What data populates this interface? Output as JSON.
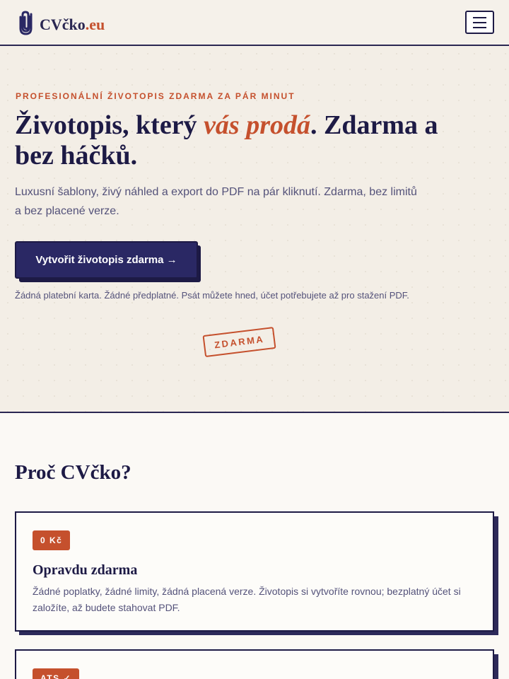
{
  "header": {
    "logo_main": "CVčko",
    "logo_tld": ".eu",
    "logo_icon": "paperclip-icon",
    "menu_icon": "hamburger-menu-icon"
  },
  "hero": {
    "eyebrow": "PROFESIONÁLNÍ ŽIVOTOPIS ZDARMA ZA PÁR MINUT",
    "headline_before": "Životopis, který ",
    "headline_accent": "vás prodá",
    "headline_after": ". Zdarma a bez háčků.",
    "lead": "Luxusní šablony, živý náhled a export do PDF na pár kliknutí. Zdarma, bez limitů a bez placené verze.",
    "cta_label": "Vytvořit životopis zdarma →",
    "note": "Žádná platební karta. Žádné předplatné. Psát můžete hned, účet potřebujete až pro stažení PDF.",
    "stamp": "ZDARMA"
  },
  "why": {
    "title": "Proč CVčko?",
    "cards": [
      {
        "badge": "0 Kč",
        "title": "Opravdu zdarma",
        "text": "Žádné poplatky, žádné limity, žádná placená verze. Životopis si vytvoříte rovnou; bezplatný účet si založíte, až budete stahovat PDF."
      },
      {
        "badge": "ATS ✓"
      }
    ]
  },
  "colors": {
    "navy": "#1d1a45",
    "accent": "#c5502d",
    "cta": "#2a2864",
    "hero_bg": "#f3eee6"
  }
}
